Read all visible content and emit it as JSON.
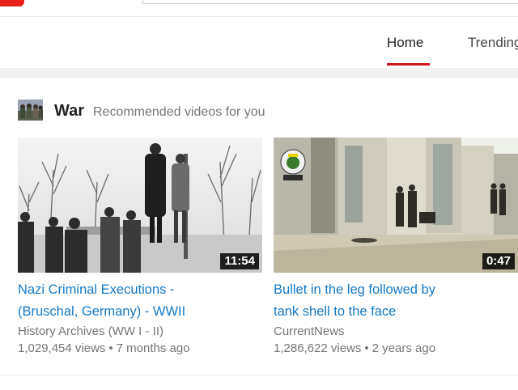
{
  "nav": {
    "home": "Home",
    "trending": "Trending"
  },
  "shelf": {
    "title": "War",
    "subtitle": "Recommended videos for you"
  },
  "videos": [
    {
      "title_line1": "Nazi Criminal Executions -",
      "title_line2": "(Bruschal, Germany) - WWII",
      "channel": "History Archives (WW I - II)",
      "views": "1,029,454 views",
      "age": "7 months ago",
      "duration": "11:54"
    },
    {
      "title_line1": "Bullet in the leg followed by",
      "title_line2": "tank shell to the face",
      "channel": "CurrentNews",
      "views": "1,286,622 views",
      "age": "2 years ago",
      "duration": "0:47"
    }
  ],
  "colors": {
    "accent": "#cc181e",
    "link": "#167ac6",
    "meta": "#767676"
  }
}
